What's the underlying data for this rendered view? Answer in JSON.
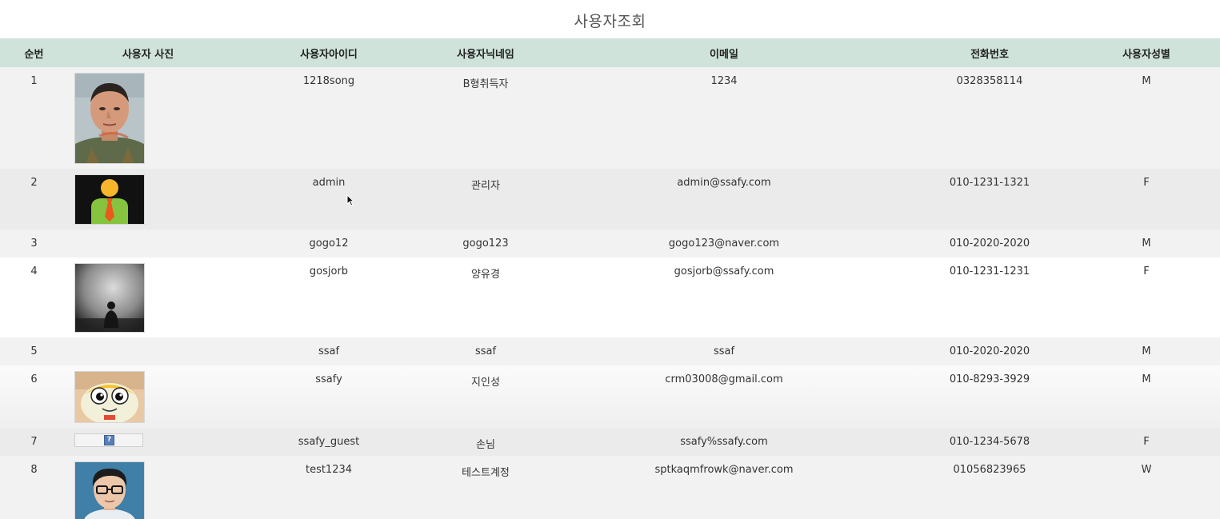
{
  "page": {
    "title": "사용자조회"
  },
  "table": {
    "headers": {
      "index": "순번",
      "photo": "사용자 사진",
      "id": "사용자아이디",
      "nickname": "사용자닉네임",
      "email": "이메일",
      "phone": "전화번호",
      "gender": "사용자성별"
    },
    "rows": [
      {
        "index": "1",
        "photo": "face-photo",
        "id": "1218song",
        "nickname": "B형취득자",
        "email": "1234",
        "phone": "0328358114",
        "gender": "M"
      },
      {
        "index": "2",
        "photo": "person-icon-photo",
        "id": "admin",
        "nickname": "관리자",
        "email": "admin@ssafy.com",
        "phone": "010-1231-1321",
        "gender": "F"
      },
      {
        "index": "3",
        "photo": "",
        "id": "gogo12",
        "nickname": "gogo123",
        "email": "gogo123@naver.com",
        "phone": "010-2020-2020",
        "gender": "M"
      },
      {
        "index": "4",
        "photo": "silhouette-photo",
        "id": "gosjorb",
        "nickname": "양유경",
        "email": "gosjorb@ssafy.com",
        "phone": "010-1231-1231",
        "gender": "F"
      },
      {
        "index": "5",
        "photo": "",
        "id": "ssaf",
        "nickname": "ssaf",
        "email": "ssaf",
        "phone": "010-2020-2020",
        "gender": "M"
      },
      {
        "index": "6",
        "photo": "frog-character-photo",
        "id": "ssafy",
        "nickname": "지인성",
        "email": "crm03008@gmail.com",
        "phone": "010-8293-3929",
        "gender": "M"
      },
      {
        "index": "7",
        "photo": "broken-image-icon",
        "id": "ssafy_guest",
        "nickname": "손님",
        "email": "ssafy%ssafy.com",
        "phone": "010-1234-5678",
        "gender": "F"
      },
      {
        "index": "8",
        "photo": "glasses-portrait-photo",
        "id": "test1234",
        "nickname": "테스트계정",
        "email": "sptkaqmfrowk@naver.com",
        "phone": "01056823965",
        "gender": "W"
      }
    ]
  },
  "colors": {
    "header_bg": "#cfe3da",
    "row_grey": "#f2f2f2",
    "row_white": "#ffffff"
  }
}
